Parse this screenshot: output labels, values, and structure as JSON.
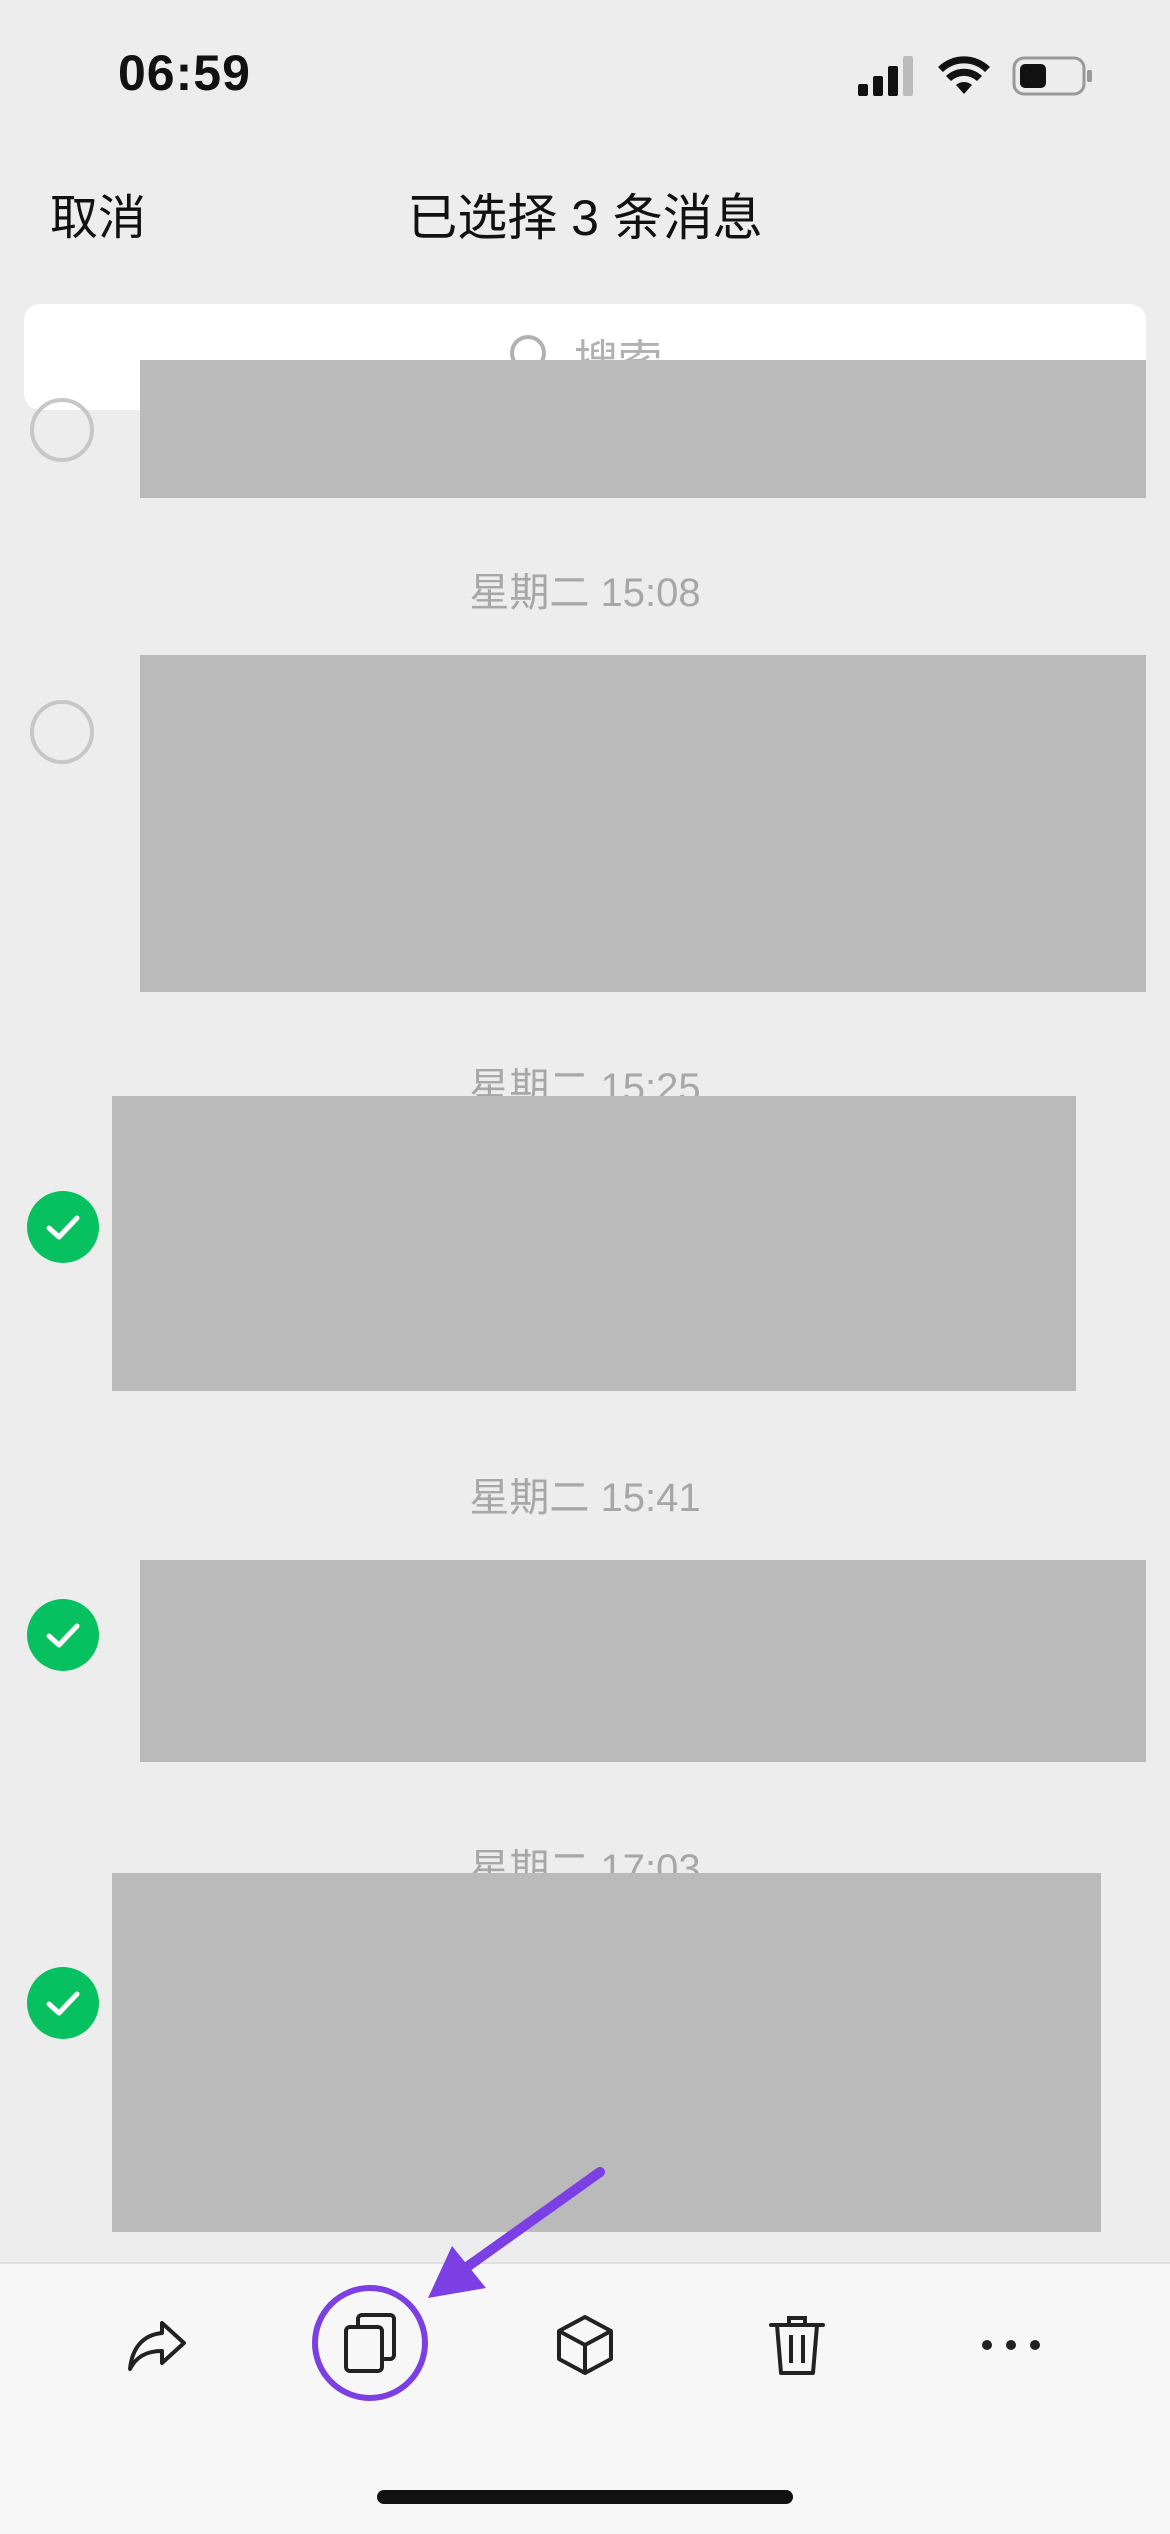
{
  "status_bar": {
    "time": "06:59",
    "icons": [
      "cellular-signal-icon",
      "wifi-icon",
      "battery-icon"
    ]
  },
  "nav": {
    "cancel_label": "取消",
    "title": "已选择 3 条消息"
  },
  "search": {
    "placeholder": "搜索",
    "icon": "search-icon"
  },
  "messages": [
    {
      "timestamp": "",
      "selected": false,
      "content_redacted": true
    },
    {
      "timestamp": "星期二 15:08",
      "selected": false,
      "content_redacted": true
    },
    {
      "timestamp": "星期二 15:25",
      "selected": true,
      "content_redacted": true
    },
    {
      "timestamp": "星期二 15:41",
      "selected": true,
      "content_redacted": true
    },
    {
      "timestamp": "星期二 17:03",
      "selected": true,
      "content_redacted": true
    }
  ],
  "toolbar": {
    "items": [
      {
        "name": "forward",
        "icon": "forward-icon"
      },
      {
        "name": "copy",
        "icon": "copy-icon",
        "highlighted": true
      },
      {
        "name": "favorite",
        "icon": "box-icon"
      },
      {
        "name": "delete",
        "icon": "trash-icon"
      },
      {
        "name": "more",
        "icon": "more-icon"
      }
    ]
  },
  "colors": {
    "background": "#ededed",
    "check_green": "#07c160",
    "highlight_purple": "#7b3fe4",
    "redaction_gray": "#bababa"
  }
}
